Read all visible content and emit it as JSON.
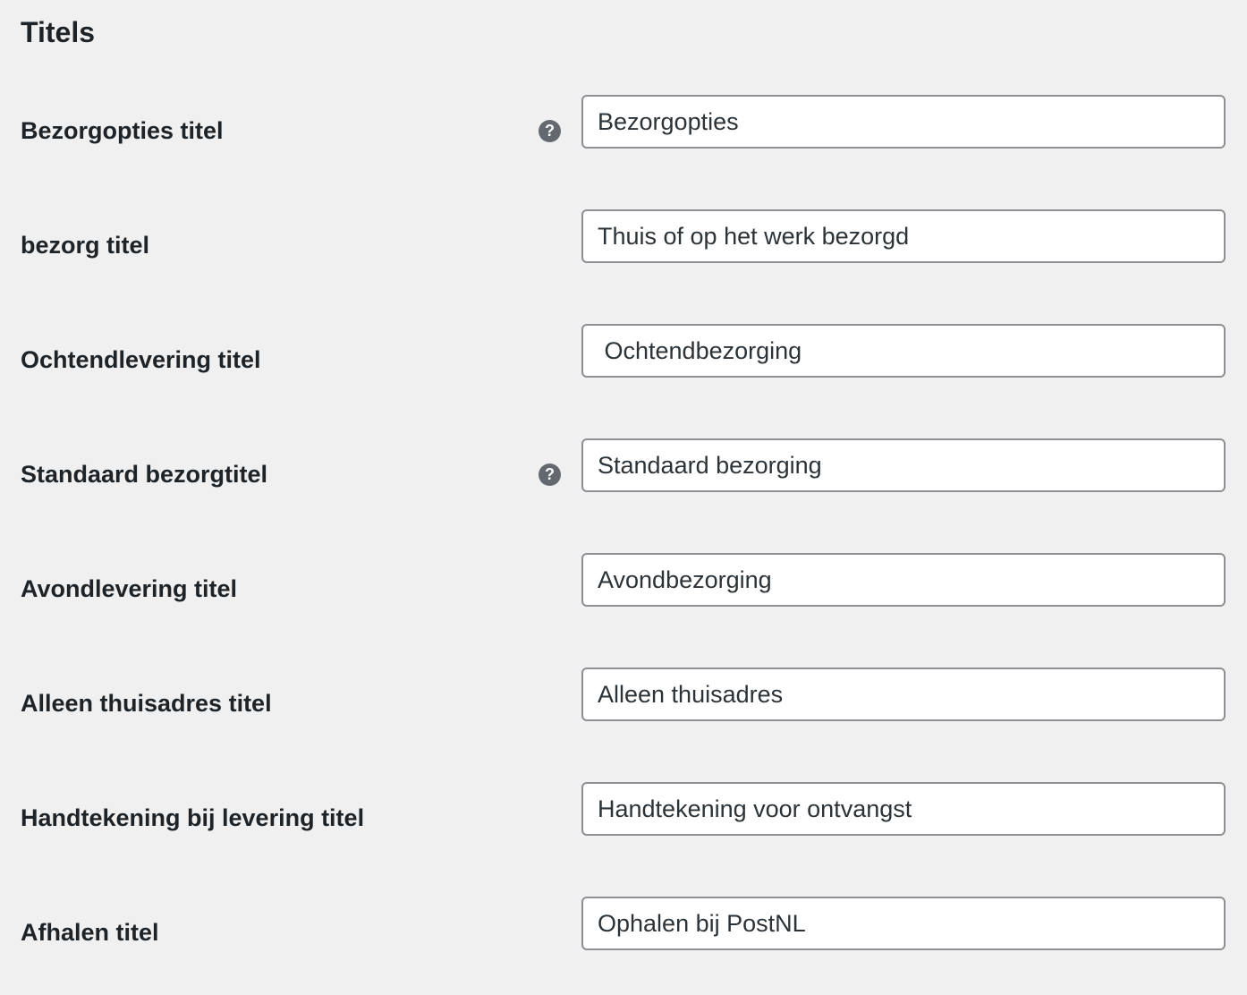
{
  "section": {
    "title": "Titels"
  },
  "fields": [
    {
      "label": "Bezorgopties titel",
      "value": "Bezorgopties",
      "has_help": true,
      "help_icon": "question-circle-icon"
    },
    {
      "label": "bezorg titel",
      "value": "Thuis of op het werk bezorgd",
      "has_help": false
    },
    {
      "label": "Ochtendlevering titel",
      "value": " Ochtendbezorging",
      "has_help": false
    },
    {
      "label": "Standaard bezorgtitel",
      "value": "Standaard bezorging",
      "has_help": true,
      "help_icon": "question-circle-icon"
    },
    {
      "label": "Avondlevering titel",
      "value": "Avondbezorging",
      "has_help": false
    },
    {
      "label": "Alleen thuisadres titel",
      "value": "Alleen thuisadres",
      "has_help": false
    },
    {
      "label": "Handtekening bij levering titel",
      "value": "Handtekening voor ontvangst",
      "has_help": false
    },
    {
      "label": "Afhalen titel",
      "value": "Ophalen bij PostNL",
      "has_help": false
    }
  ],
  "colors": {
    "background": "#f0f0f1",
    "label_text": "#1d2327",
    "input_border": "#8c8f94",
    "help_icon": "#646970"
  }
}
